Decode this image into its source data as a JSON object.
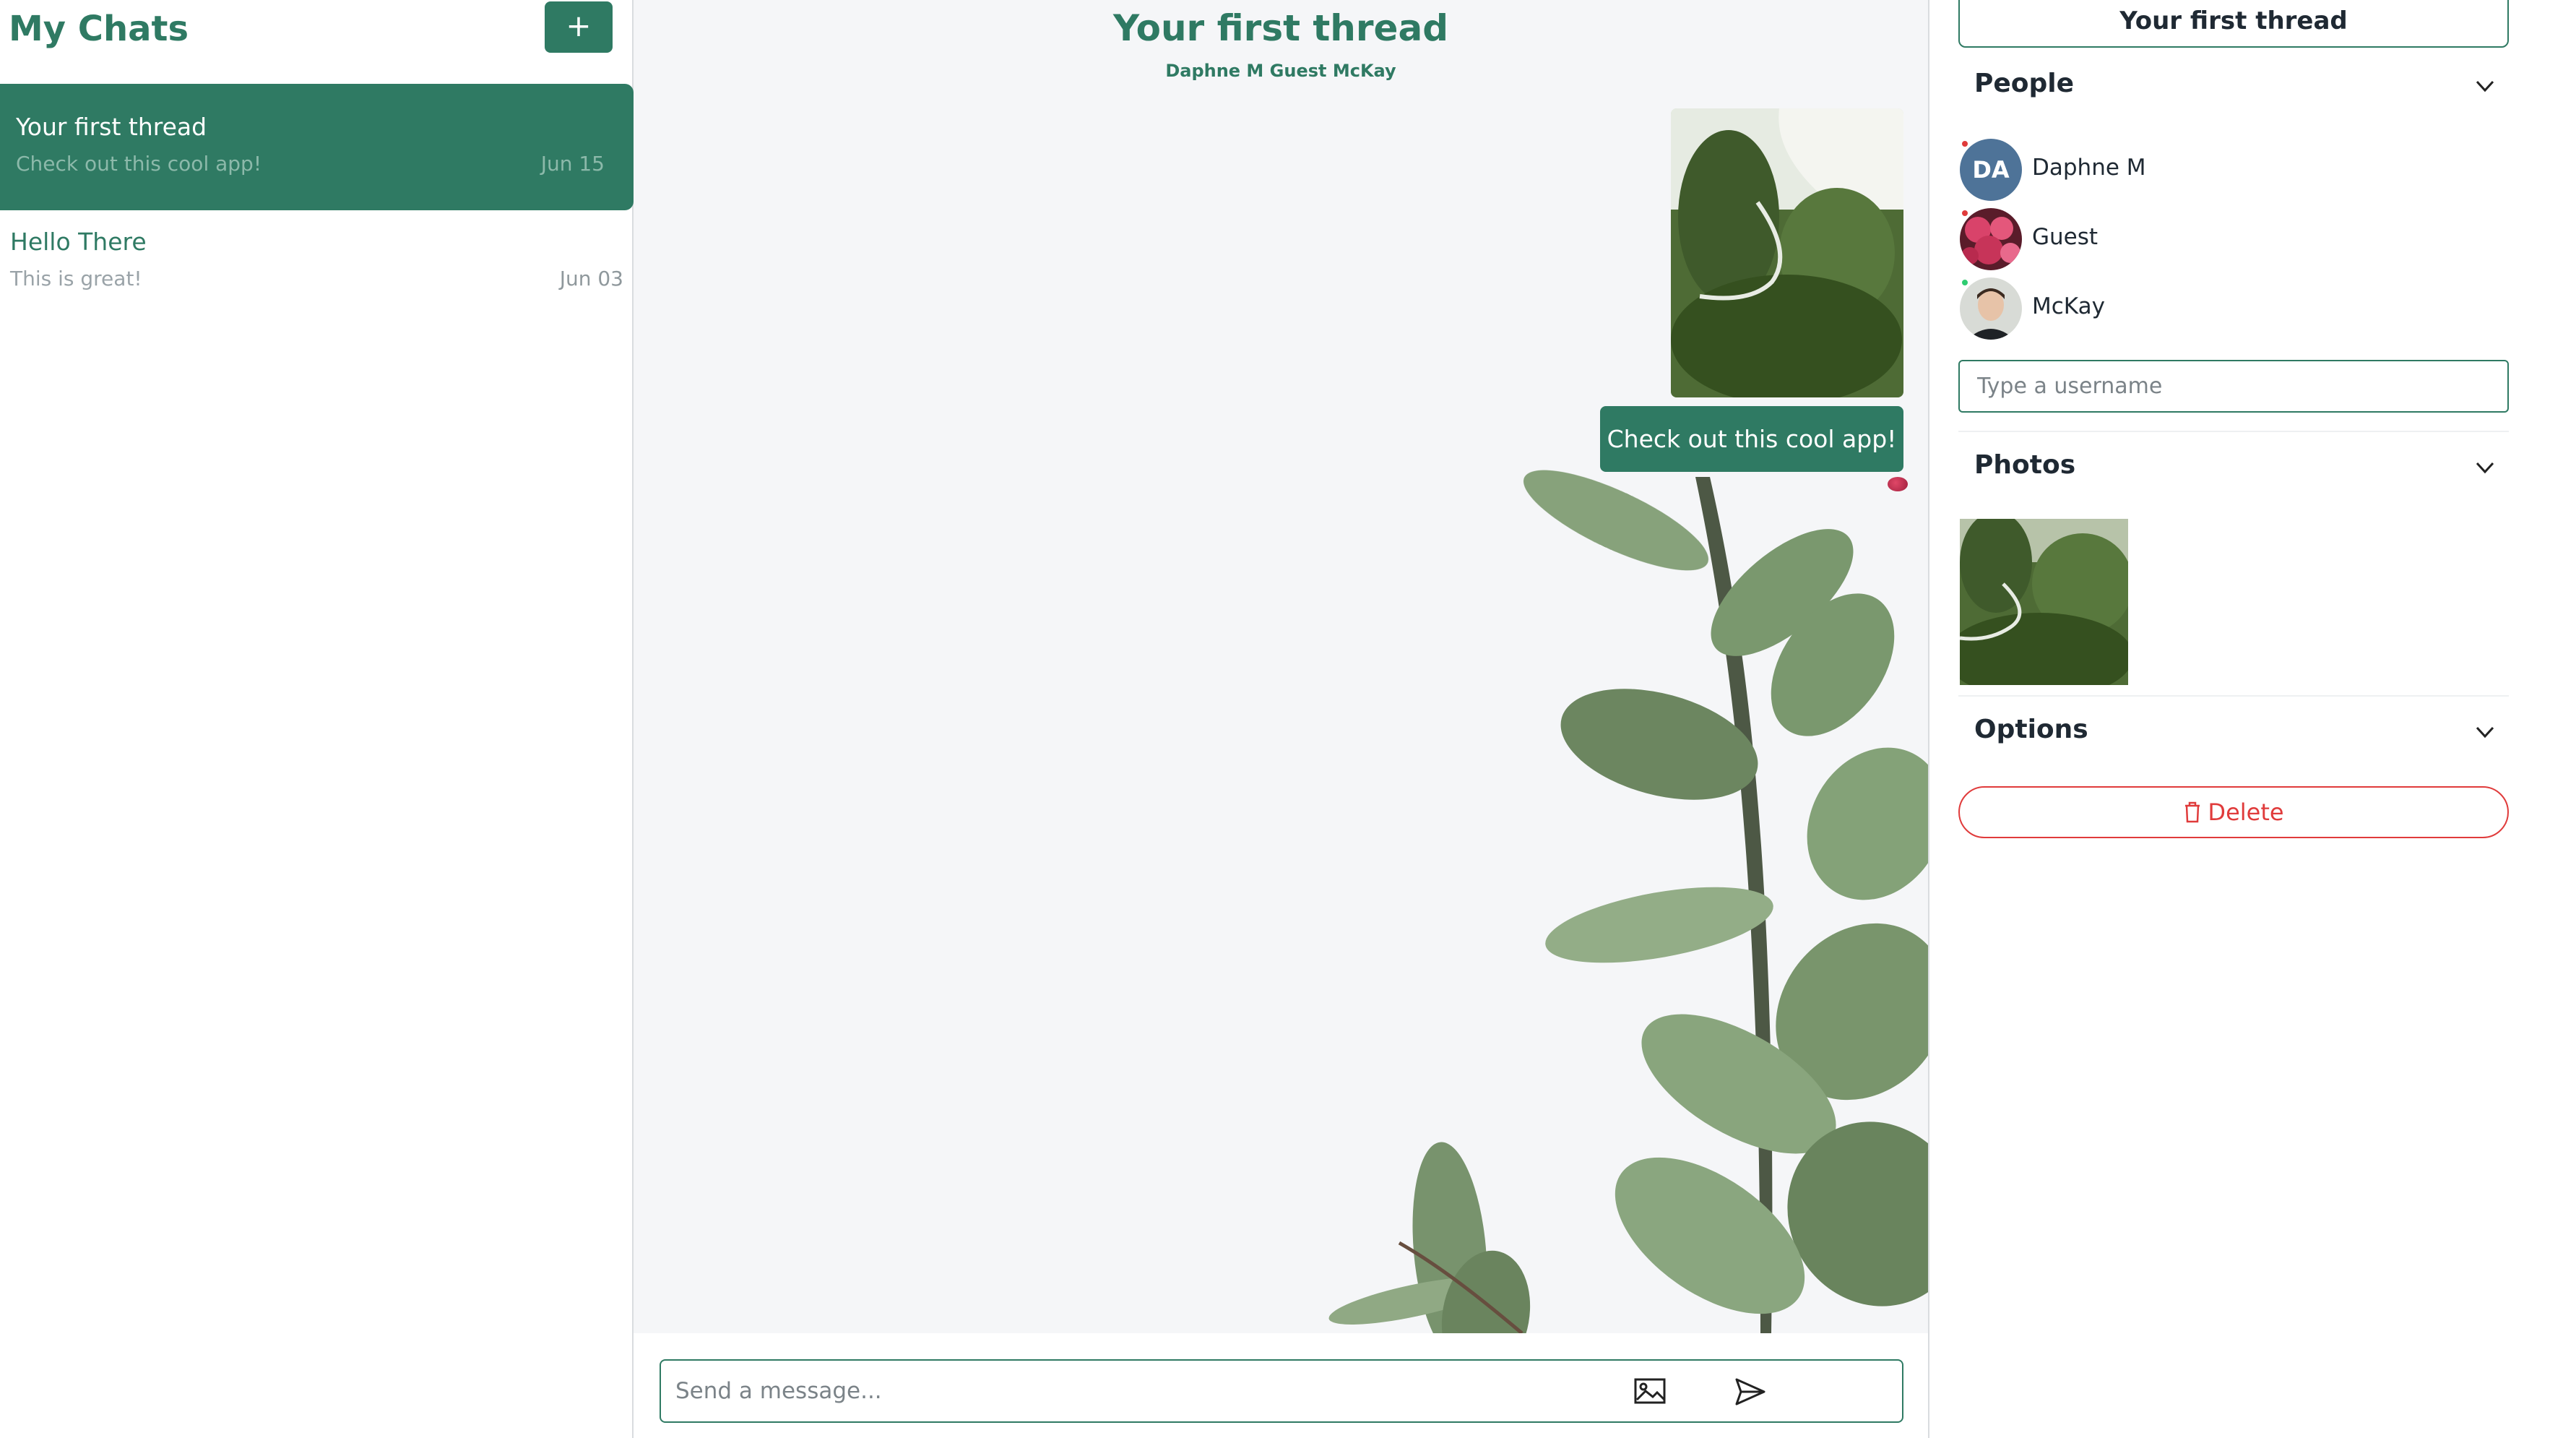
{
  "sidebar": {
    "title": "My Chats",
    "new_button_label": "+",
    "chats": [
      {
        "name": "Your first thread",
        "preview": "Check out this cool app!",
        "date": "Jun 15"
      },
      {
        "name": "Hello There",
        "preview": "This is great!",
        "date": "Jun 03"
      }
    ]
  },
  "thread": {
    "title": "Your first thread",
    "members": "Daphne M Guest McKay",
    "messages": [
      {
        "type": "image",
        "icon": "garden-photo"
      },
      {
        "type": "text",
        "text": "Check out this cool app!"
      }
    ]
  },
  "composer": {
    "placeholder": "Send a message...",
    "image_icon": "image-icon",
    "send_icon": "send-icon"
  },
  "details": {
    "title": "Your first thread",
    "people_header": "People",
    "people": [
      {
        "name": "Daphne M",
        "initials": "DA",
        "status": "offline"
      },
      {
        "name": "Guest",
        "avatar": "flower-photo",
        "status": "offline"
      },
      {
        "name": "McKay",
        "avatar": "person-photo",
        "status": "online"
      }
    ],
    "username_placeholder": "Type a username",
    "photos_header": "Photos",
    "options_header": "Options",
    "delete_label": "Delete"
  },
  "colors": {
    "accent": "#2f7a63",
    "danger": "#e03b3b",
    "background": "#f5f6f8"
  }
}
